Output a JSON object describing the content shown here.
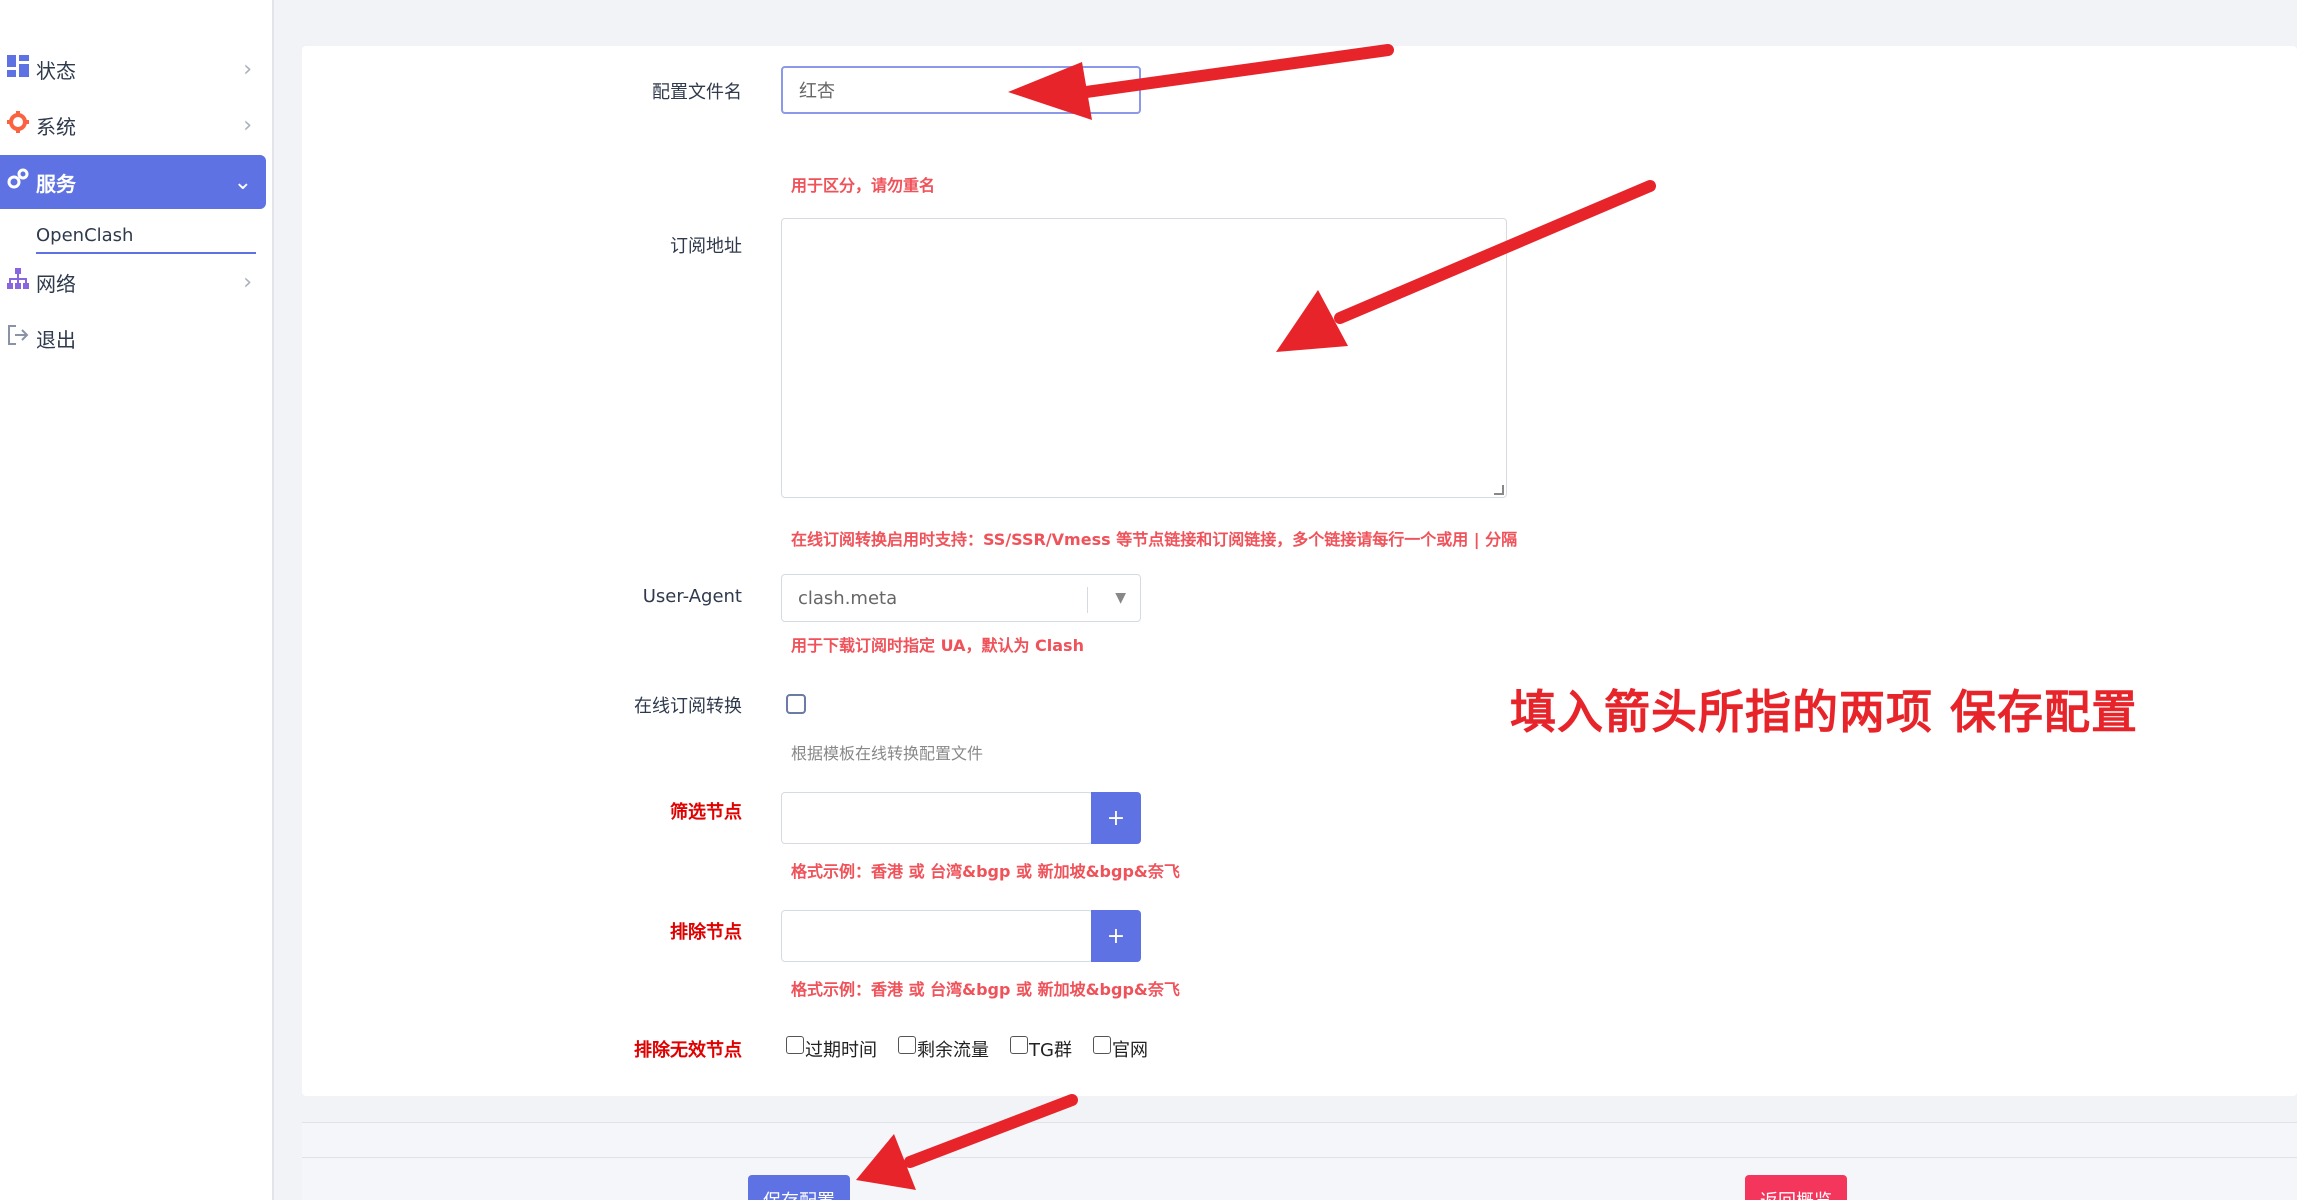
{
  "sidebar": {
    "items": [
      {
        "label": "状态",
        "icon": "dashboard-icon"
      },
      {
        "label": "系统",
        "icon": "gear-icon"
      },
      {
        "label": "服务",
        "icon": "gears-icon"
      },
      {
        "label": "网络",
        "icon": "sitemap-icon"
      },
      {
        "label": "退出",
        "icon": "logout-icon"
      }
    ],
    "sub_item": "OpenClash"
  },
  "form": {
    "config_name": {
      "label": "配置文件名",
      "value": "红杏",
      "hint": "用于区分，请勿重名"
    },
    "subscribe_url": {
      "label": "订阅地址",
      "value": "",
      "hint": "在线订阅转换启用时支持：SS/SSR/Vmess 等节点链接和订阅链接，多个链接请每行一个或用 | 分隔"
    },
    "user_agent": {
      "label": "User-Agent",
      "value": "clash.meta",
      "hint": "用于下载订阅时指定 UA，默认为 Clash"
    },
    "online_convert": {
      "label": "在线订阅转换",
      "hint": "根据模板在线转换配置文件"
    },
    "filter_nodes": {
      "label": "筛选节点",
      "hint": "格式示例：香港 或 台湾&bgp 或 新加坡&bgp&奈飞",
      "add": "+"
    },
    "exclude_nodes": {
      "label": "排除节点",
      "hint": "格式示例：香港 或 台湾&bgp 或 新加坡&bgp&奈飞",
      "add": "+"
    },
    "exclude_invalid": {
      "label": "排除无效节点",
      "options": [
        "过期时间",
        "剩余流量",
        "TG群",
        "官网"
      ]
    }
  },
  "annotation": "填入箭头所指的两项  保存配置",
  "footer": {
    "save": "保存配置",
    "back": "返回概览"
  },
  "colors": {
    "accent": "#5e72e4",
    "danger": "#f5365c",
    "arrow": "#e8242b"
  }
}
